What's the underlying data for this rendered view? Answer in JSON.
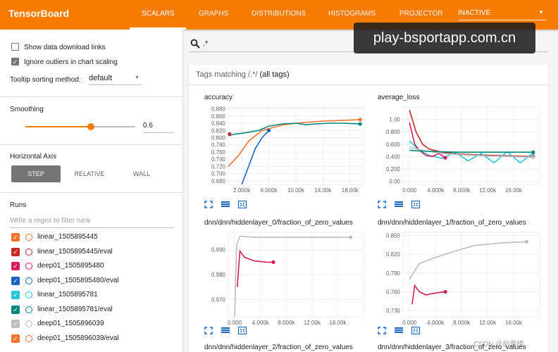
{
  "topbar": {
    "brand": "TensorBoard",
    "tabs": [
      {
        "label": "SCALARS",
        "active": true
      },
      {
        "label": "GRAPHS",
        "active": false
      },
      {
        "label": "DISTRIBUTIONS",
        "active": false
      },
      {
        "label": "HISTOGRAMS",
        "active": false
      },
      {
        "label": "PROJECTOR",
        "active": false
      }
    ],
    "run_select": "INACTIVE",
    "accent": "#f57c00"
  },
  "watermark": "play-bsportapp.com.cn",
  "sidebar": {
    "show_download_links": {
      "label": "Show data download links",
      "checked": false
    },
    "ignore_outliers": {
      "label": "Ignore outliers in chart scaling",
      "checked": true
    },
    "tooltip_sort": {
      "label": "Tooltip sorting method:",
      "value": "default"
    },
    "smoothing": {
      "title": "Smoothing",
      "value": "0.6",
      "fraction": 0.6
    },
    "horizontal_axis": {
      "title": "Horizontal Axis",
      "options": [
        {
          "label": "STEP",
          "active": true
        },
        {
          "label": "RELATIVE",
          "active": false
        },
        {
          "label": "WALL",
          "active": false
        }
      ]
    },
    "runs": {
      "title": "Runs",
      "filter_placeholder": "Write a regex to filter runs",
      "items": [
        {
          "label": "linear_1505895445",
          "color": "#f4732e",
          "checked": true
        },
        {
          "label": "linear_1505895445/eval",
          "color": "#c62828",
          "checked": true
        },
        {
          "label": "deep01_1505895480",
          "color": "#d81b60",
          "checked": true
        },
        {
          "label": "deep01_1505895480/eval",
          "color": "#1565c0",
          "checked": true
        },
        {
          "label": "linear_1505895781",
          "color": "#26c6da",
          "checked": true
        },
        {
          "label": "linear_1505895781/eval",
          "color": "#00897b",
          "checked": true
        },
        {
          "label": "deep01_1505896039",
          "color": "#bdbdbd",
          "checked": true
        },
        {
          "label": "deep01_1505896039/eval",
          "color": "#f4732e",
          "checked": true
        }
      ]
    }
  },
  "search": {
    "value": ".*",
    "icon": "search-icon"
  },
  "tags": {
    "prefix": "Tags matching ",
    "pattern": "/.*/",
    "suffix": " (all tags)"
  },
  "charts": [
    {
      "title": "accuracy"
    },
    {
      "title": "average_loss"
    },
    {
      "title": "dnn/dnn/hiddenlayer_0/fraction_of_zero_values"
    },
    {
      "title": "dnn/dnn/hiddenlayer_1/fraction_of_zero_values"
    },
    {
      "title": "dnn/dnn/hiddenlayer_2/fraction_of_zero_values"
    },
    {
      "title": "dnn/dnn/hiddenlayer_3/fraction_of_zero_values"
    }
  ],
  "chart_data": [
    {
      "type": "line",
      "title": "accuracy",
      "x_ticks": [
        "2.000k",
        "6.000k",
        "10.00k",
        "14.00k",
        "18.00k"
      ],
      "y_ticks": [
        "0.880",
        "0.860",
        "0.840",
        "0.820",
        "0.800",
        "0.780",
        "0.760",
        "0.740",
        "0.720",
        "0.700",
        "0.680"
      ],
      "xlim": [
        0,
        20000
      ],
      "ylim": [
        0.67,
        0.885
      ],
      "series": [
        {
          "color": "#f4732e",
          "points": [
            [
              0,
              0.72
            ],
            [
              1500,
              0.75
            ],
            [
              3000,
              0.79
            ],
            [
              5000,
              0.82
            ],
            [
              8000,
              0.835
            ],
            [
              11000,
              0.842
            ],
            [
              14000,
              0.846
            ],
            [
              17000,
              0.848
            ],
            [
              19500,
              0.85
            ]
          ]
        },
        {
          "color": "#00897b",
          "points": [
            [
              0,
              0.805
            ],
            [
              1000,
              0.81
            ],
            [
              2000,
              0.812
            ],
            [
              3000,
              0.815
            ],
            [
              4500,
              0.82
            ],
            [
              6000,
              0.832
            ],
            [
              8000,
              0.838
            ],
            [
              10000,
              0.84
            ],
            [
              11500,
              0.836
            ],
            [
              13000,
              0.838
            ],
            [
              15000,
              0.84
            ],
            [
              17000,
              0.84
            ],
            [
              19500,
              0.838
            ]
          ]
        },
        {
          "color": "#1565c0",
          "points": [
            [
              2000,
              0.67
            ],
            [
              3000,
              0.72
            ],
            [
              4000,
              0.77
            ],
            [
              5000,
              0.8
            ],
            [
              6000,
              0.82
            ]
          ]
        },
        {
          "color": "#c62828",
          "points": [
            [
              200,
              0.81
            ]
          ]
        }
      ]
    },
    {
      "type": "line",
      "title": "average_loss",
      "x_ticks": [
        "0.000",
        "4.000k",
        "8.000k",
        "12.00k",
        "16.00k"
      ],
      "y_ticks": [
        "1.00",
        "0.800",
        "0.600",
        "0.400",
        "0.200",
        "0.00"
      ],
      "xlim": [
        -1000,
        20000
      ],
      "ylim": [
        -0.05,
        1.2
      ],
      "series": [
        {
          "color": "#c62828",
          "points": [
            [
              0,
              1.15
            ],
            [
              1000,
              0.8
            ],
            [
              2000,
              0.6
            ],
            [
              3000,
              0.52
            ],
            [
              5000,
              0.47
            ],
            [
              8000,
              0.44
            ],
            [
              12000,
              0.42
            ],
            [
              16000,
              0.41
            ],
            [
              19000,
              0.4
            ]
          ]
        },
        {
          "color": "#26c6da",
          "points": [
            [
              0,
              0.65
            ],
            [
              1500,
              0.5
            ],
            [
              3000,
              0.42
            ],
            [
              5000,
              0.37
            ],
            [
              7000,
              0.47
            ],
            [
              9000,
              0.33
            ],
            [
              11000,
              0.45
            ],
            [
              13000,
              0.3
            ],
            [
              15000,
              0.48
            ],
            [
              17000,
              0.3
            ],
            [
              19000,
              0.46
            ]
          ]
        },
        {
          "color": "#d81b60",
          "points": [
            [
              0,
              0.95
            ],
            [
              800,
              0.6
            ],
            [
              1500,
              0.5
            ],
            [
              2500,
              0.42
            ],
            [
              3500,
              0.4
            ],
            [
              4500,
              0.45
            ],
            [
              5500,
              0.38
            ]
          ]
        },
        {
          "color": "#bdbdbd",
          "points": [
            [
              0,
              0.55
            ],
            [
              2000,
              0.5
            ],
            [
              5000,
              0.45
            ],
            [
              8000,
              0.43
            ],
            [
              12000,
              0.41
            ],
            [
              16000,
              0.4
            ],
            [
              19000,
              0.39
            ]
          ]
        },
        {
          "color": "#00897b",
          "points": [
            [
              0,
              0.5
            ],
            [
              4000,
              0.48
            ],
            [
              8000,
              0.47
            ],
            [
              12000,
              0.47
            ],
            [
              16000,
              0.47
            ],
            [
              19000,
              0.47
            ]
          ]
        }
      ]
    },
    {
      "type": "line",
      "title": "dnn/dnn/hiddenlayer_0/fraction_of_zero_values",
      "x_ticks": [
        "0.000",
        "4.000k",
        "8.000k",
        "12.00k",
        "16.00k"
      ],
      "y_ticks": [
        "0.990",
        "0.980",
        "0.970"
      ],
      "xlim": [
        -1000,
        20000
      ],
      "ylim": [
        0.963,
        0.997
      ],
      "series": [
        {
          "color": "#bdbdbd",
          "points": [
            [
              0,
              0.963
            ],
            [
              300,
              0.992
            ],
            [
              800,
              0.9955
            ],
            [
              3000,
              0.995
            ],
            [
              6000,
              0.995
            ],
            [
              10000,
              0.995
            ],
            [
              14000,
              0.995
            ],
            [
              18000,
              0.995
            ]
          ]
        },
        {
          "color": "#d81b60",
          "points": [
            [
              400,
              0.975
            ],
            [
              800,
              0.9895
            ],
            [
              1500,
              0.987
            ],
            [
              3000,
              0.9855
            ],
            [
              5000,
              0.985
            ],
            [
              6000,
              0.985
            ]
          ]
        }
      ]
    },
    {
      "type": "line",
      "title": "dnn/dnn/hiddenlayer_1/fraction_of_zero_values",
      "x_ticks": [
        "0.000",
        "4.000k",
        "8.000k",
        "12.00k",
        "16.00k"
      ],
      "y_ticks": [
        "0.850",
        "0.820",
        "0.790",
        "0.760",
        "0.730"
      ],
      "xlim": [
        -1000,
        20000
      ],
      "ylim": [
        0.72,
        0.855
      ],
      "series": [
        {
          "color": "#bdbdbd",
          "points": [
            [
              0,
              0.78
            ],
            [
              1500,
              0.805
            ],
            [
              4000,
              0.815
            ],
            [
              7000,
              0.825
            ],
            [
              10000,
              0.834
            ],
            [
              14000,
              0.838
            ],
            [
              18000,
              0.84
            ]
          ]
        },
        {
          "color": "#d81b60",
          "points": [
            [
              400,
              0.74
            ],
            [
              800,
              0.77
            ],
            [
              1500,
              0.76
            ],
            [
              2500,
              0.755
            ],
            [
              4000,
              0.758
            ],
            [
              5500,
              0.76
            ]
          ]
        }
      ]
    }
  ],
  "bottom_titles": [
    "dnn/dnn/hiddenlayer_2/fraction_of_zero_values",
    "dnn/dnn/hiddenlayer_3/fraction_of_zero_values"
  ],
  "footer_watermark": "CSDN @前南楼"
}
